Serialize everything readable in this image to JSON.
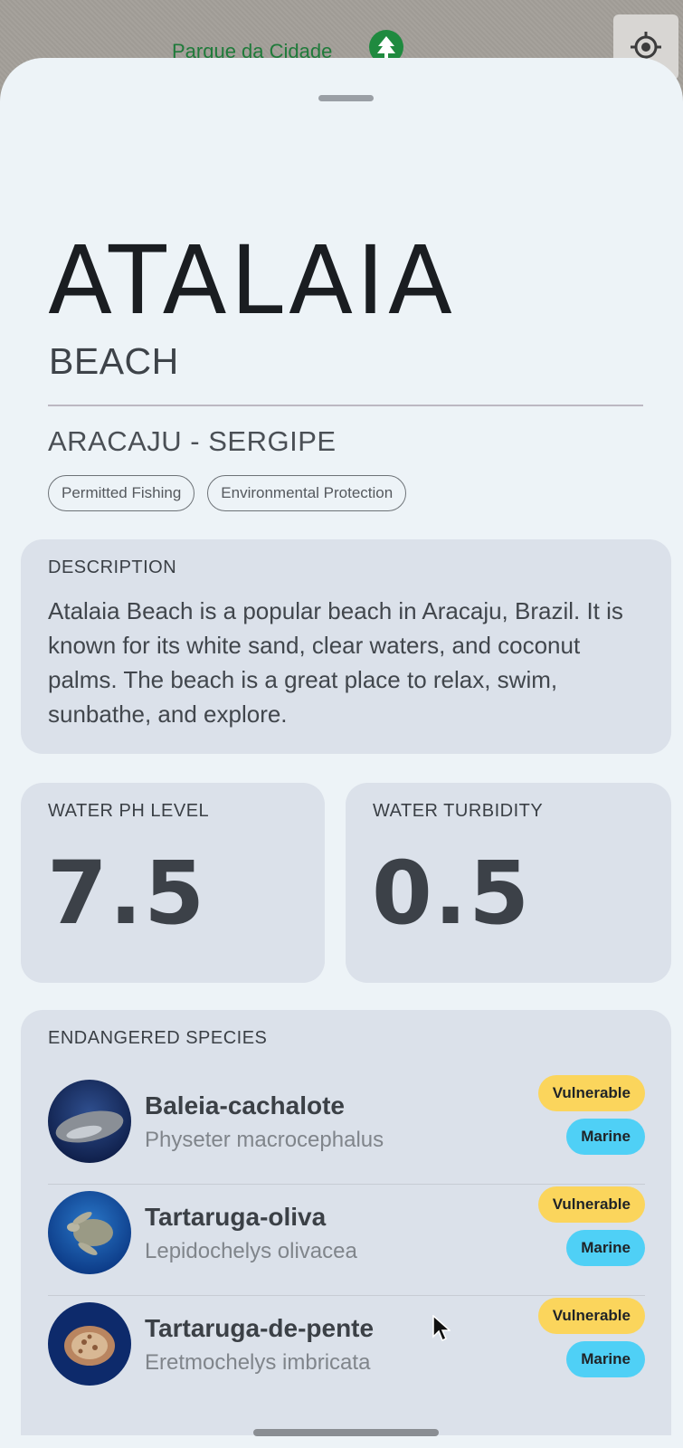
{
  "map": {
    "place_label": "Parque da Cidade",
    "pin_icon": "tree-icon",
    "locate_icon": "my-location-icon"
  },
  "beach": {
    "name": "ATALAIA",
    "type": "BEACH",
    "location": "ARACAJU - SERGIPE",
    "tags": [
      "Permitted Fishing",
      "Environmental Protection"
    ]
  },
  "description": {
    "label": "DESCRIPTION",
    "text": "Atalaia Beach is a popular beach in Aracaju, Brazil. It is known for its white sand, clear waters, and coconut palms. The beach is a great place to relax, swim, sunbathe, and explore."
  },
  "metrics": {
    "ph": {
      "label": "WATER PH LEVEL",
      "value": "7.5"
    },
    "turbidity": {
      "label": "WATER TURBIDITY",
      "value": "0.5"
    }
  },
  "species": {
    "label": "ENDANGERED SPECIES",
    "items": [
      {
        "common": "Baleia-cachalote",
        "scientific": "Physeter macrocephalus",
        "status": "Vulnerable",
        "habitat": "Marine",
        "image": "sperm-whale-photo"
      },
      {
        "common": "Tartaruga-oliva",
        "scientific": "Lepidochelys olivacea",
        "status": "Vulnerable",
        "habitat": "Marine",
        "image": "olive-ridley-turtle-photo"
      },
      {
        "common": "Tartaruga-de-pente",
        "scientific": "Eretmochelys imbricata",
        "status": "Vulnerable",
        "habitat": "Marine",
        "image": "hawksbill-turtle-photo"
      }
    ]
  },
  "colors": {
    "sheet_bg": "#edf3f7",
    "card_bg": "#dbe1ea",
    "vulnerable_badge": "#fbd55c",
    "marine_badge": "#4fd0f6"
  }
}
